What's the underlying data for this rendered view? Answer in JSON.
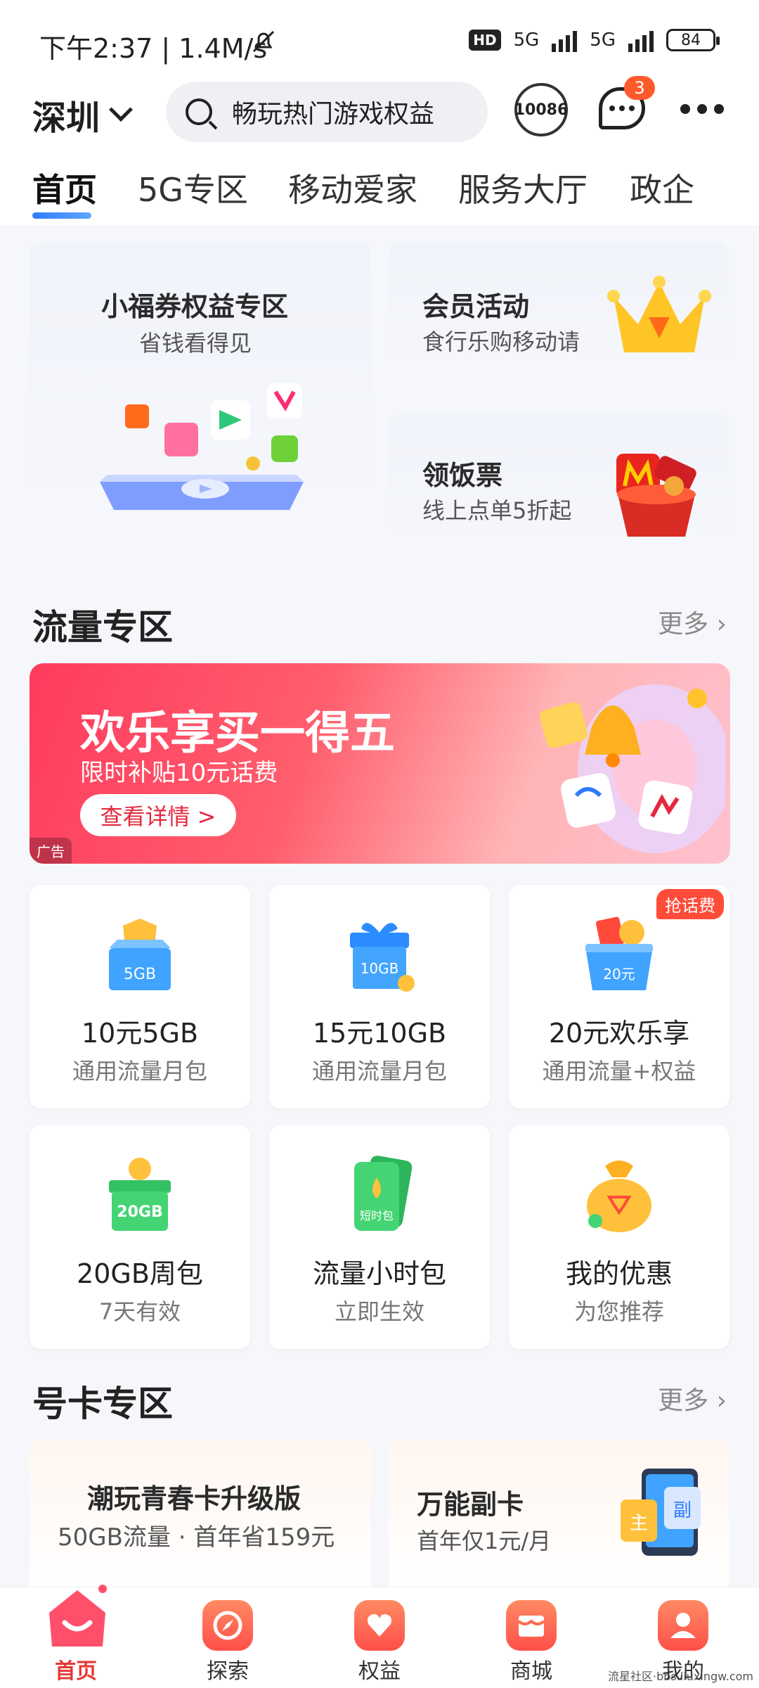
{
  "status_bar": {
    "time": "下午2:37 | 1.4M/s",
    "hd": "HD",
    "net1": "5G",
    "net2": "5G",
    "battery": "84"
  },
  "header": {
    "city": "深圳",
    "search_text": "畅玩热门游戏权益",
    "service_label": "10086",
    "message_count": "3"
  },
  "tabs": [
    "首页",
    "5G专区",
    "移动爱家",
    "服务大厅",
    "政企"
  ],
  "features": {
    "left": {
      "title": "小福券权益专区",
      "subtitle": "省钱看得见"
    },
    "right_top": {
      "title": "会员活动",
      "subtitle": "食行乐购移动请"
    },
    "right_bottom": {
      "title": "领饭票",
      "subtitle": "线上点单5折起"
    }
  },
  "traffic_section": {
    "title": "流量专区",
    "more": "更多",
    "banner": {
      "title": "欢乐享买一得五",
      "subtitle": "限时补贴10元话费",
      "button": "查看详情 >",
      "ad_tag": "广告"
    },
    "items": [
      {
        "title": "10元5GB",
        "subtitle": "通用流量月包",
        "icon_text": "5GB"
      },
      {
        "title": "15元10GB",
        "subtitle": "通用流量月包",
        "icon_text": "10GB"
      },
      {
        "title": "20元欢乐享",
        "subtitle": "通用流量+权益",
        "icon_text": "20元",
        "tag": "抢话费"
      },
      {
        "title": "20GB周包",
        "subtitle": "7天有效",
        "icon_text": "20GB"
      },
      {
        "title": "流量小时包",
        "subtitle": "立即生效",
        "icon_text": "短时包"
      },
      {
        "title": "我的优惠",
        "subtitle": "为您推荐",
        "icon_text": ""
      }
    ]
  },
  "card_section": {
    "title": "号卡专区",
    "more": "更多",
    "cards": [
      {
        "title": "潮玩青春卡升级版",
        "subtitle": "50GB流量 · 首年省159元"
      },
      {
        "title": "万能副卡",
        "subtitle": "首年仅1元/月",
        "badge_main": "主",
        "badge_sub": "副"
      }
    ]
  },
  "bottom_nav": [
    "首页",
    "探索",
    "权益",
    "商城",
    "我的"
  ],
  "watermark": "流星社区·bbs.liuxingw.com"
}
